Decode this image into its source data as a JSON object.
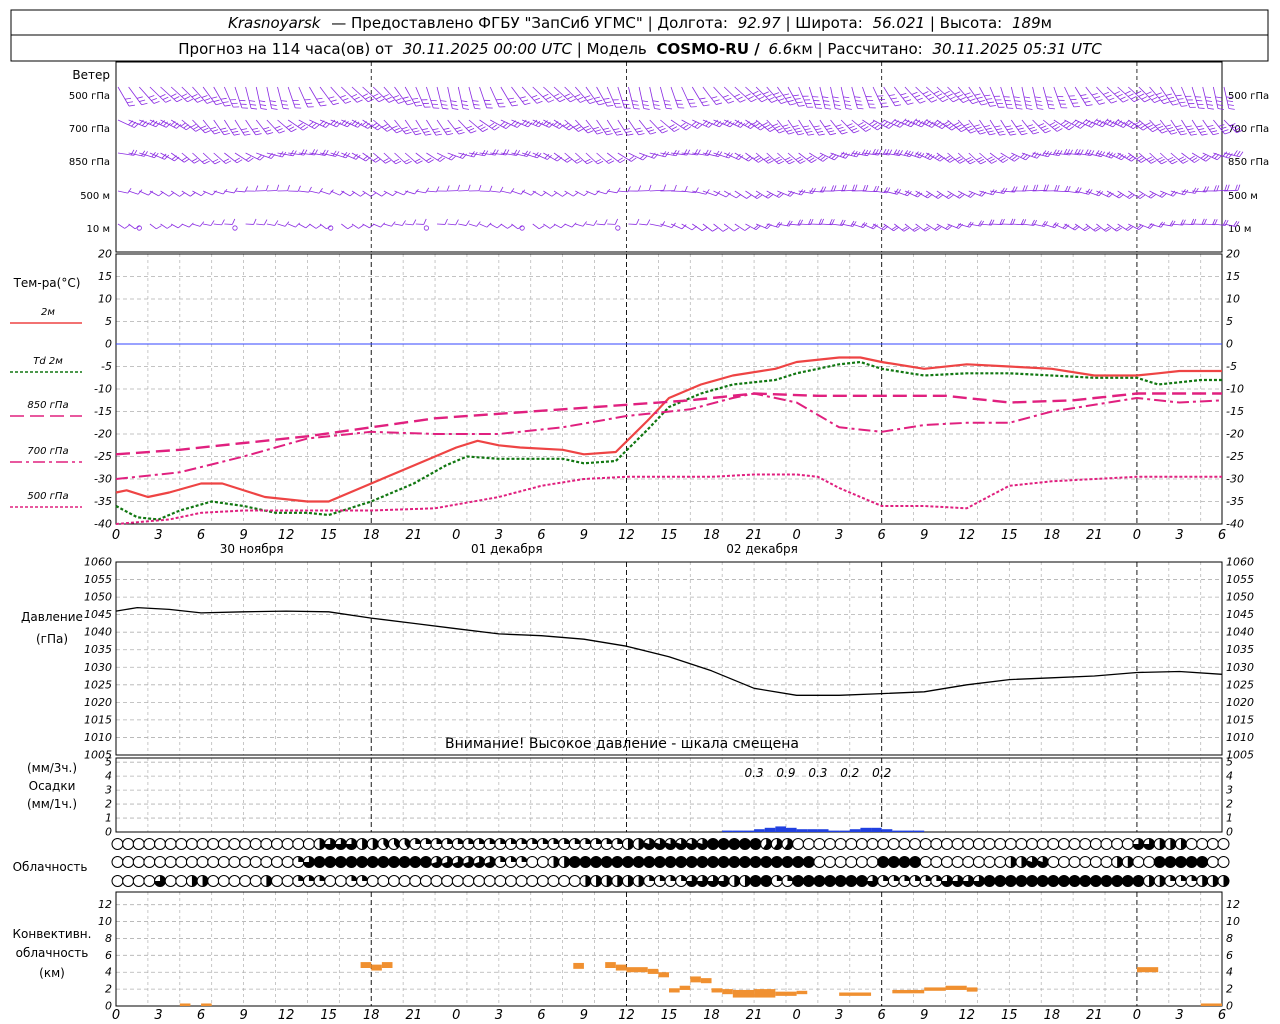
{
  "header": {
    "station": "Krasnoyarsk",
    "provider": "— Предоставлено ФГБУ \"ЗапСиб УГМС\"",
    "lon_label": "Долгота:",
    "lon": "92.97",
    "lat_label": "Широта:",
    "lat": "56.021",
    "alt_label": "Высота:",
    "alt": "189",
    "alt_unit": "м",
    "forecast_label": "Прогноз на 114 часа(ов)  от",
    "forecast_start": "30.11.2025 00:00 UTC",
    "model_label": "Модель",
    "model": "COSMO-RU /",
    "resolution": "6.6",
    "resolution_unit": "км",
    "calc_label": "Рассчитано:",
    "calc_time": "30.11.2025 05:31 UTC"
  },
  "wind_panel": {
    "title": "Ветер",
    "levels": [
      "500 гПа",
      "700 гПа",
      "850 гПа",
      "500 м",
      "10 м"
    ],
    "color": "#8a2be2"
  },
  "colors": {
    "t2m": "#ee4444",
    "td2m": "#117711",
    "t850": "#e0207f",
    "t700": "#e0207f",
    "t500": "#e0207f",
    "pressure": "#000000",
    "precip": "#2040e0",
    "conv": "#f09030",
    "zero": "#3344ff",
    "grid": "#b0b0b0"
  },
  "axes": {
    "hours": [
      "0",
      "3",
      "6",
      "9",
      "12",
      "15",
      "18",
      "21",
      "0",
      "3",
      "6",
      "9",
      "12",
      "15",
      "18",
      "21",
      "0",
      "3",
      "6",
      "9",
      "12",
      "15",
      "18",
      "21",
      "0",
      "3",
      "6"
    ],
    "days": [
      "30 ноября",
      "01 декабря",
      "02 декабря"
    ]
  },
  "temp_panel": {
    "title": "Тем-ра(°С)",
    "legend": [
      {
        "label": "2м",
        "style": "solid"
      },
      {
        "label": "Td  2м",
        "style": "dotted"
      },
      {
        "label": "850 гПа",
        "style": "dash"
      },
      {
        "label": "700 гПа",
        "style": "dashdot"
      },
      {
        "label": "500 гПа",
        "style": "dotted"
      }
    ],
    "yticks": [
      "20",
      "15",
      "10",
      "5",
      "0",
      "-5",
      "-10",
      "-15",
      "-20",
      "-25",
      "-30",
      "-35",
      "-40"
    ]
  },
  "pressure_panel": {
    "title": "Давление",
    "unit": "(гПа)",
    "warning": "Внимание! Высокое давление - шкала смещена",
    "yticks": [
      "1060",
      "1055",
      "1050",
      "1045",
      "1040",
      "1035",
      "1030",
      "1025",
      "1020",
      "1015",
      "1010",
      "1005"
    ]
  },
  "precip_panel": {
    "unit3": "(мм/3ч.)",
    "title": "Осадки",
    "unit1": "(мм/1ч.)",
    "yticks": [
      "5",
      "4",
      "3",
      "2",
      "1",
      "0"
    ],
    "labels": [
      {
        "h": 60,
        "text": "0.3"
      },
      {
        "h": 63,
        "text": "0.9"
      },
      {
        "h": 66,
        "text": "0.3"
      },
      {
        "h": 69,
        "text": "0.2"
      },
      {
        "h": 72,
        "text": "0.2"
      }
    ]
  },
  "cloud_panel": {
    "title": "Облачность"
  },
  "conv_panel": {
    "title_line1": "Конвективн.",
    "title_line2": "облачность",
    "unit": "(км)",
    "yticks": [
      "12",
      "10",
      "8",
      "6",
      "4",
      "2",
      "0"
    ]
  },
  "chart_data": [
    {
      "type": "line",
      "title": "Тем-ра(°С)",
      "x_unit": "hours from 30.11.2025 00:00 UTC",
      "ylim": [
        -40,
        20
      ],
      "grid": true,
      "series": [
        {
          "name": "2м",
          "x": [
            0,
            1,
            3,
            5,
            8,
            10,
            14,
            18,
            20,
            24,
            28,
            32,
            34,
            36,
            38,
            42,
            44,
            47,
            50,
            52,
            55,
            58,
            62,
            64,
            68,
            70,
            72,
            76,
            80,
            84,
            88,
            92,
            96,
            98,
            100,
            102,
            104
          ],
          "y": [
            -33,
            -32.5,
            -34,
            -33,
            -31,
            -31,
            -34,
            -35,
            -35,
            -31,
            -27,
            -23,
            -21.5,
            -22.5,
            -23,
            -23.5,
            -24.5,
            -24,
            -17,
            -12,
            -9,
            -7,
            -5.5,
            -4,
            -3,
            -3,
            -4,
            -5.5,
            -4.5,
            -5,
            -5.5,
            -7,
            -7,
            -6.5,
            -6,
            -6,
            -6
          ]
        },
        {
          "name": "Td  2м",
          "x": [
            0,
            2,
            4,
            6,
            9,
            12,
            15,
            18,
            20,
            24,
            28,
            31,
            33,
            36,
            40,
            42,
            44,
            47,
            50,
            52,
            55,
            58,
            62,
            64,
            68,
            70,
            72,
            76,
            80,
            84,
            88,
            92,
            96,
            98,
            100,
            102,
            104
          ],
          "y": [
            -36,
            -38.5,
            -39,
            -37,
            -35,
            -36,
            -37.5,
            -37.5,
            -38,
            -35,
            -31,
            -27,
            -25,
            -25.5,
            -25.5,
            -25.5,
            -26.5,
            -26,
            -19,
            -14,
            -11,
            -9,
            -8,
            -6.5,
            -4.5,
            -4,
            -5.5,
            -7,
            -6.5,
            -6.5,
            -7,
            -7.5,
            -7.5,
            -9,
            -8.5,
            -8,
            -8
          ]
        },
        {
          "name": "850 гПа",
          "x": [
            0,
            6,
            12,
            18,
            24,
            30,
            36,
            42,
            48,
            54,
            60,
            66,
            72,
            78,
            84,
            90,
            96,
            102,
            104
          ],
          "y": [
            -24.5,
            -23.5,
            -22,
            -20.5,
            -18.5,
            -16.5,
            -15.5,
            -14.5,
            -13.5,
            -12.5,
            -11,
            -11.5,
            -11.5,
            -11.5,
            -13,
            -12.5,
            -11,
            -11,
            -11
          ]
        },
        {
          "name": "700 гПа",
          "x": [
            0,
            6,
            12,
            18,
            24,
            30,
            36,
            42,
            48,
            54,
            58,
            60,
            64,
            68,
            72,
            76,
            80,
            84,
            88,
            92,
            96,
            98,
            100,
            104
          ],
          "y": [
            -30,
            -28.5,
            -25,
            -21,
            -19.5,
            -20,
            -20,
            -18.5,
            -16,
            -14.5,
            -12,
            -11,
            -13,
            -18.5,
            -19.5,
            -18,
            -17.5,
            -17.5,
            -15,
            -13.5,
            -12,
            -12.5,
            -13,
            -12.5
          ]
        },
        {
          "name": "500 гПа",
          "x": [
            0,
            5,
            8,
            12,
            18,
            24,
            30,
            36,
            40,
            44,
            48,
            52,
            56,
            60,
            64,
            66,
            68,
            72,
            76,
            80,
            82,
            84,
            88,
            92,
            96,
            100,
            104
          ],
          "y": [
            -40,
            -39,
            -37.5,
            -37,
            -37,
            -37,
            -36.5,
            -34,
            -31.5,
            -30,
            -29.5,
            -29.5,
            -29.5,
            -29,
            -29,
            -29.5,
            -32,
            -36,
            -36,
            -36.5,
            -34,
            -31.5,
            -30.5,
            -30,
            -29.5,
            -29.5,
            -29.5
          ]
        }
      ]
    },
    {
      "type": "line",
      "title": "Давление",
      "ylabel": "(гПа)",
      "ylim": [
        1005,
        1060
      ],
      "series": [
        {
          "name": "Давление",
          "x": [
            0,
            2,
            5,
            8,
            12,
            16,
            20,
            24,
            28,
            32,
            36,
            40,
            44,
            48,
            52,
            56,
            60,
            64,
            68,
            72,
            76,
            80,
            84,
            88,
            92,
            96,
            100,
            104
          ],
          "y": [
            1046,
            1047,
            1046.5,
            1045.5,
            1045.8,
            1046,
            1045.8,
            1044,
            1042.5,
            1041,
            1039.5,
            1039,
            1038,
            1036,
            1033,
            1029,
            1024,
            1022,
            1022,
            1022.5,
            1023,
            1025,
            1026.5,
            1027,
            1027.5,
            1028.5,
            1028.8,
            1028
          ]
        }
      ]
    },
    {
      "type": "bar",
      "title": "Осадки",
      "ylabel": "(мм/1ч.)",
      "ylim": [
        0,
        5
      ],
      "x": [
        57,
        58,
        59,
        60,
        61,
        62,
        63,
        64,
        65,
        66,
        67,
        68,
        69,
        70,
        71,
        72,
        73,
        74,
        75
      ],
      "values": [
        0.1,
        0.1,
        0.1,
        0.2,
        0.3,
        0.4,
        0.3,
        0.2,
        0.2,
        0.2,
        0.1,
        0.1,
        0.2,
        0.3,
        0.3,
        0.2,
        0.1,
        0.1,
        0.1
      ]
    },
    {
      "type": "heatmap",
      "title": "Облачность",
      "step_hours": 1,
      "rows": [
        "high",
        "middle",
        "low"
      ],
      "runs": {
        "high": [
          [
            0,
            18,
            0
          ],
          [
            19,
            20,
            0.5
          ],
          [
            20,
            23,
            0.75
          ],
          [
            23,
            25,
            0.5
          ],
          [
            25,
            28,
            0.4
          ],
          [
            28,
            48,
            0.25
          ],
          [
            48,
            50,
            0.5
          ],
          [
            50,
            56,
            0.8
          ],
          [
            56,
            61,
            1
          ],
          [
            61,
            64,
            0.6
          ],
          [
            64,
            86,
            0
          ],
          [
            86,
            96,
            0
          ],
          [
            96,
            98,
            0.75
          ],
          [
            98,
            101,
            0.5
          ],
          [
            101,
            105,
            0
          ]
        ],
        "middle": [
          [
            0,
            17,
            0
          ],
          [
            17,
            18,
            0.25
          ],
          [
            18,
            19,
            0.75
          ],
          [
            19,
            30,
            1
          ],
          [
            30,
            36,
            0.7
          ],
          [
            36,
            39,
            0.25
          ],
          [
            39,
            41,
            0
          ],
          [
            41,
            43,
            0.5
          ],
          [
            43,
            66,
            1
          ],
          [
            66,
            72,
            0
          ],
          [
            72,
            76,
            1
          ],
          [
            76,
            84,
            0
          ],
          [
            84,
            86,
            0.5
          ],
          [
            86,
            88,
            0.8
          ],
          [
            88,
            94,
            0
          ],
          [
            94,
            96,
            0.5
          ],
          [
            96,
            98,
            0
          ],
          [
            98,
            103,
            1
          ],
          [
            103,
            105,
            0
          ]
        ],
        "low": [
          [
            0,
            4,
            0
          ],
          [
            4,
            5,
            0.75
          ],
          [
            5,
            7,
            0
          ],
          [
            7,
            9,
            0.5
          ],
          [
            9,
            14,
            0
          ],
          [
            14,
            15,
            0.5
          ],
          [
            15,
            17,
            0
          ],
          [
            17,
            20,
            0.25
          ],
          [
            20,
            22,
            0
          ],
          [
            22,
            24,
            0.25
          ],
          [
            24,
            44,
            0
          ],
          [
            44,
            50,
            0.5
          ],
          [
            50,
            54,
            0.25
          ],
          [
            54,
            58,
            0.75
          ],
          [
            58,
            60,
            0.5
          ],
          [
            60,
            62,
            1
          ],
          [
            62,
            64,
            0.25
          ],
          [
            64,
            71,
            1
          ],
          [
            71,
            72,
            0.75
          ],
          [
            72,
            78,
            0.25
          ],
          [
            78,
            82,
            0.75
          ],
          [
            82,
            97,
            1
          ],
          [
            97,
            99,
            0.5
          ],
          [
            99,
            102,
            0.25
          ],
          [
            102,
            105,
            0.5
          ]
        ]
      }
    },
    {
      "type": "bar",
      "title": "Конвективн. облачность",
      "ylabel": "(км)",
      "ylim": [
        0,
        13
      ],
      "bars": [
        {
          "x0": 6,
          "x1": 7,
          "lo": 0,
          "hi": 0.3
        },
        {
          "x0": 8,
          "x1": 9,
          "lo": 0,
          "hi": 0.3
        },
        {
          "x0": 23,
          "x1": 24,
          "lo": 4.5,
          "hi": 5.2
        },
        {
          "x0": 24,
          "x1": 25,
          "lo": 4.2,
          "hi": 4.9
        },
        {
          "x0": 25,
          "x1": 26,
          "lo": 4.5,
          "hi": 5.2
        },
        {
          "x0": 43,
          "x1": 44,
          "lo": 4.4,
          "hi": 5.1
        },
        {
          "x0": 46,
          "x1": 47,
          "lo": 4.5,
          "hi": 5.2
        },
        {
          "x0": 47,
          "x1": 48,
          "lo": 4.2,
          "hi": 4.9
        },
        {
          "x0": 48,
          "x1": 50,
          "lo": 4,
          "hi": 4.6
        },
        {
          "x0": 50,
          "x1": 51,
          "lo": 3.8,
          "hi": 4.4
        },
        {
          "x0": 51,
          "x1": 52,
          "lo": 3.4,
          "hi": 4
        },
        {
          "x0": 52,
          "x1": 53,
          "lo": 1.6,
          "hi": 2.1
        },
        {
          "x0": 53,
          "x1": 54,
          "lo": 1.9,
          "hi": 2.4
        },
        {
          "x0": 54,
          "x1": 55,
          "lo": 2.8,
          "hi": 3.5
        },
        {
          "x0": 55,
          "x1": 56,
          "lo": 2.7,
          "hi": 3.3
        },
        {
          "x0": 56,
          "x1": 57,
          "lo": 1.6,
          "hi": 2.1
        },
        {
          "x0": 57,
          "x1": 58,
          "lo": 1.4,
          "hi": 2
        },
        {
          "x0": 58,
          "x1": 60,
          "lo": 1,
          "hi": 1.9
        },
        {
          "x0": 60,
          "x1": 62,
          "lo": 1,
          "hi": 2
        },
        {
          "x0": 62,
          "x1": 64,
          "lo": 1.2,
          "hi": 1.7
        },
        {
          "x0": 64,
          "x1": 65,
          "lo": 1.4,
          "hi": 1.8
        },
        {
          "x0": 68,
          "x1": 71,
          "lo": 1.2,
          "hi": 1.6
        },
        {
          "x0": 73,
          "x1": 76,
          "lo": 1.5,
          "hi": 1.9
        },
        {
          "x0": 76,
          "x1": 78,
          "lo": 1.8,
          "hi": 2.2
        },
        {
          "x0": 78,
          "x1": 80,
          "lo": 1.9,
          "hi": 2.4
        },
        {
          "x0": 80,
          "x1": 81,
          "lo": 1.7,
          "hi": 2.2
        },
        {
          "x0": 96,
          "x1": 98,
          "lo": 4,
          "hi": 4.6
        },
        {
          "x0": 102,
          "x1": 104,
          "lo": 0,
          "hi": 0.3
        }
      ]
    }
  ]
}
